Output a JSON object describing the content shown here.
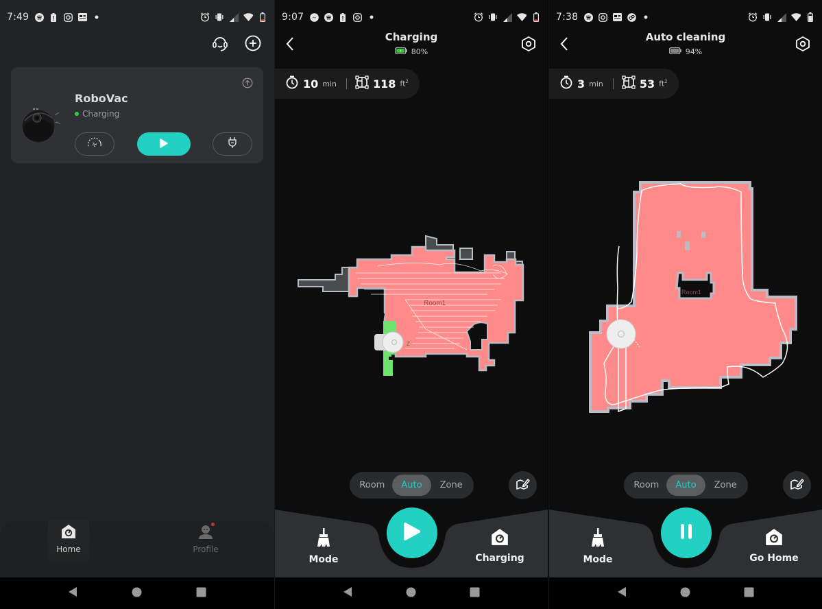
{
  "theme": {
    "accent": "#22d1c2",
    "room_fill": "#ff8a8a",
    "wall": "#b9bcc4",
    "zone_green": "#6ee36e",
    "unexplored": "#4a4b4d",
    "status_green": "#2ecc40"
  },
  "panel_home": {
    "statusbar": {
      "time": "7:49",
      "left_icons": [
        "spotify-icon",
        "battery-alert-icon",
        "instagram-icon",
        "news-icon",
        "dot-icon"
      ],
      "right_icons": [
        "alarm-icon",
        "vibrate-icon",
        "signal-icon",
        "wifi-icon",
        "battery-low-icon"
      ]
    },
    "top_icons": [
      "support-headset-icon",
      "add-device-icon"
    ],
    "device": {
      "name": "RoboVac",
      "status": "Charging",
      "buttons": [
        "suction-power-button",
        "start-button",
        "dock-charge-button"
      ]
    },
    "nav": [
      {
        "label": "Home",
        "icon": "home-icon",
        "active": true
      },
      {
        "label": "Profile",
        "icon": "profile-icon",
        "active": false,
        "notification": true
      }
    ]
  },
  "panel_charging": {
    "statusbar": {
      "time": "9:07",
      "left_icons": [
        "messenger-icon",
        "spotify-icon",
        "battery-alert-icon",
        "instagram-icon",
        "dot-icon"
      ],
      "right_icons": [
        "alarm-icon",
        "vibrate-icon",
        "signal-icon",
        "wifi-icon",
        "battery-low-icon"
      ]
    },
    "title": "Charging",
    "battery": {
      "percent_label": "80%",
      "percent": 80,
      "charging": true
    },
    "stats": {
      "time_value": "10",
      "time_unit": "min",
      "area_value": "118",
      "area_unit": "ft",
      "area_sup": "2"
    },
    "map": {
      "room_label": "Room1",
      "zone_label": "Z"
    },
    "modes": {
      "options": [
        "Room",
        "Auto",
        "Zone"
      ],
      "active": "Auto"
    },
    "actions": {
      "left_label": "Mode",
      "right_label": "Charging",
      "main_state": "play"
    }
  },
  "panel_cleaning": {
    "statusbar": {
      "time": "7:38",
      "left_icons": [
        "spotify-icon",
        "instagram-icon",
        "news-icon",
        "app-icon",
        "dot-icon"
      ],
      "right_icons": [
        "alarm-icon",
        "vibrate-icon",
        "signal-icon",
        "wifi-icon",
        "battery-icon"
      ]
    },
    "title": "Auto cleaning",
    "battery": {
      "percent_label": "94%",
      "percent": 94,
      "charging": false
    },
    "stats": {
      "time_value": "3",
      "time_unit": "min",
      "area_value": "53",
      "area_unit": "ft",
      "area_sup": "2"
    },
    "map": {
      "room_label": "Room1"
    },
    "modes": {
      "options": [
        "Room",
        "Auto",
        "Zone"
      ],
      "active": "Auto"
    },
    "actions": {
      "left_label": "Mode",
      "right_label": "Go Home",
      "main_state": "pause"
    }
  }
}
